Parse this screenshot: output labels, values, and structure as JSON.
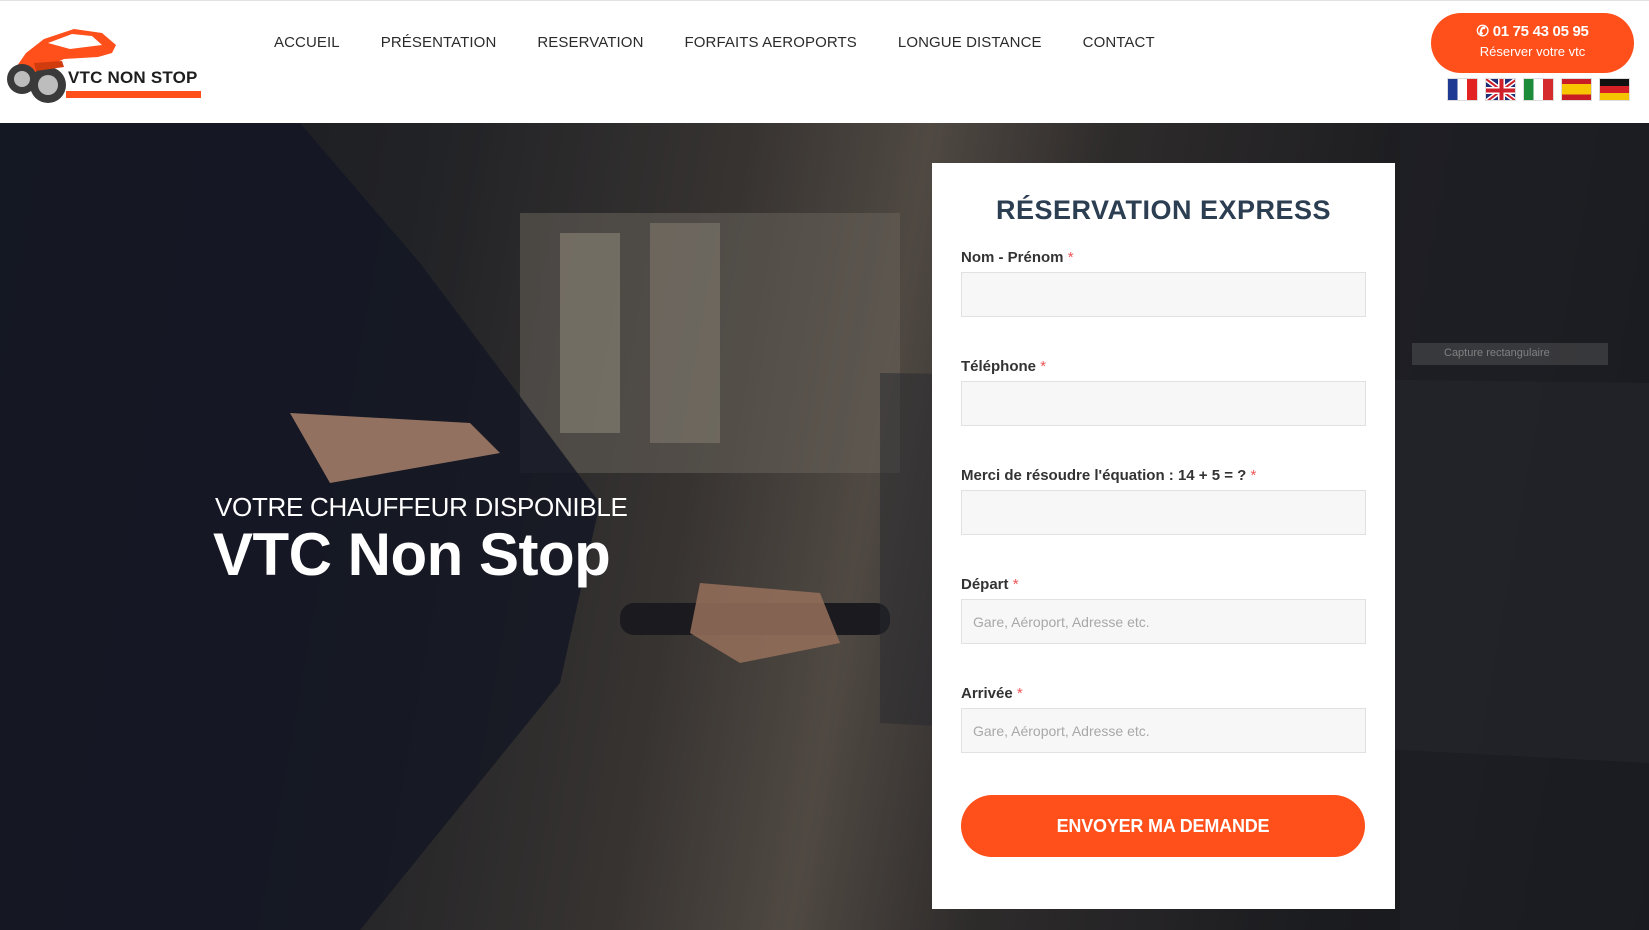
{
  "brand": {
    "logo_text": "VTC NON STOP",
    "accent": "#ff4f1a",
    "title_color": "#2c3e52"
  },
  "nav": {
    "items": [
      {
        "label": "ACCUEIL"
      },
      {
        "label": "PRÉSENTATION"
      },
      {
        "label": "RESERVATION"
      },
      {
        "label": "FORFAITS AEROPORTS"
      },
      {
        "label": "LONGUE DISTANCE"
      },
      {
        "label": "CONTACT"
      }
    ]
  },
  "cta": {
    "phone": "01 75 43 05 95",
    "label": "Réserver votre vtc",
    "icon": "phone-icon"
  },
  "languages": [
    {
      "code": "fr",
      "icon": "flag-france-icon"
    },
    {
      "code": "en",
      "icon": "flag-uk-icon"
    },
    {
      "code": "it",
      "icon": "flag-italy-icon"
    },
    {
      "code": "es",
      "icon": "flag-spain-icon"
    },
    {
      "code": "de",
      "icon": "flag-germany-icon"
    }
  ],
  "hero": {
    "kicker": "VOTRE CHAUFFEUR DISPONIBLE",
    "title": "VTC Non Stop"
  },
  "form": {
    "title": "RÉSERVATION EXPRESS",
    "required_mark": "*",
    "fields": [
      {
        "label": "Nom - Prénom",
        "value": "",
        "placeholder": ""
      },
      {
        "label": "Téléphone",
        "value": "",
        "placeholder": ""
      },
      {
        "label": "Merci de résoudre l'équation : 14 + 5 = ?",
        "value": "",
        "placeholder": ""
      },
      {
        "label": "Départ",
        "value": "",
        "placeholder": "Gare, Aéroport, Adresse etc."
      },
      {
        "label": "Arrivée",
        "value": "",
        "placeholder": "Gare, Aéroport, Adresse etc."
      }
    ],
    "submit_label": "ENVOYER MA DEMANDE"
  },
  "overlay_tooltip": {
    "label": "Capture rectangulaire"
  }
}
